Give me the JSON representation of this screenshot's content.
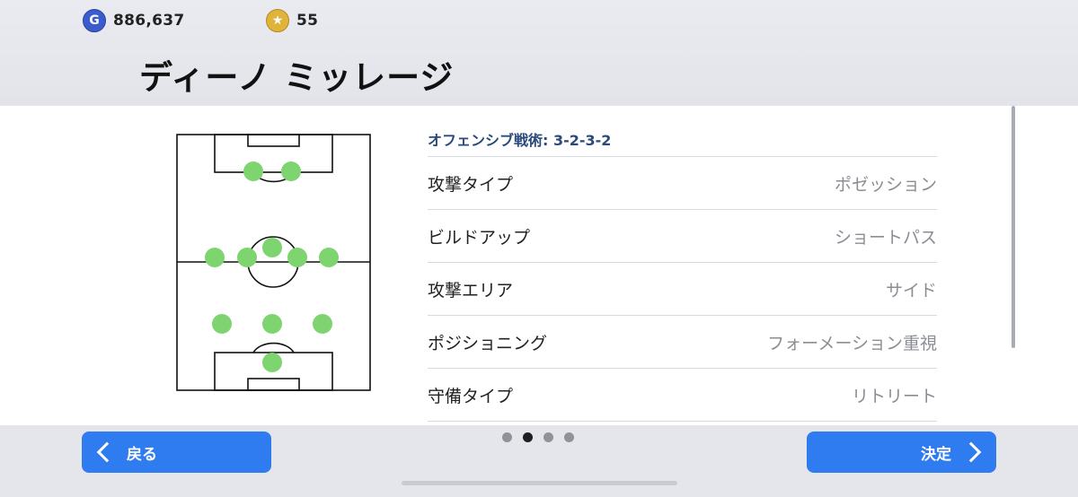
{
  "currency": {
    "gp": {
      "icon": "g-coin-icon",
      "glyph": "G",
      "value": "886,637"
    },
    "coins": {
      "icon": "star-coin-icon",
      "glyph": "★",
      "value": "55"
    }
  },
  "manager": {
    "name": "ディーノ ミッレージ"
  },
  "formation": {
    "name": "3-2-3-2",
    "player_dot_color": "#7ed46f"
  },
  "tactics": {
    "header": "オフェンシブ戦術: 3-2-3-2",
    "rows": [
      {
        "label": "攻撃タイプ",
        "value": "ポゼッション"
      },
      {
        "label": "ビルドアップ",
        "value": "ショートパス"
      },
      {
        "label": "攻撃エリア",
        "value": "サイド"
      },
      {
        "label": "ポジショニング",
        "value": "フォーメーション重視"
      },
      {
        "label": "守備タイプ",
        "value": "リトリート"
      }
    ]
  },
  "pagination": {
    "pages": 4,
    "current": 2
  },
  "buttons": {
    "back": "戻る",
    "confirm": "決定"
  },
  "colors": {
    "accent": "#2f7cf0",
    "header_text": "#2b4a7c"
  }
}
